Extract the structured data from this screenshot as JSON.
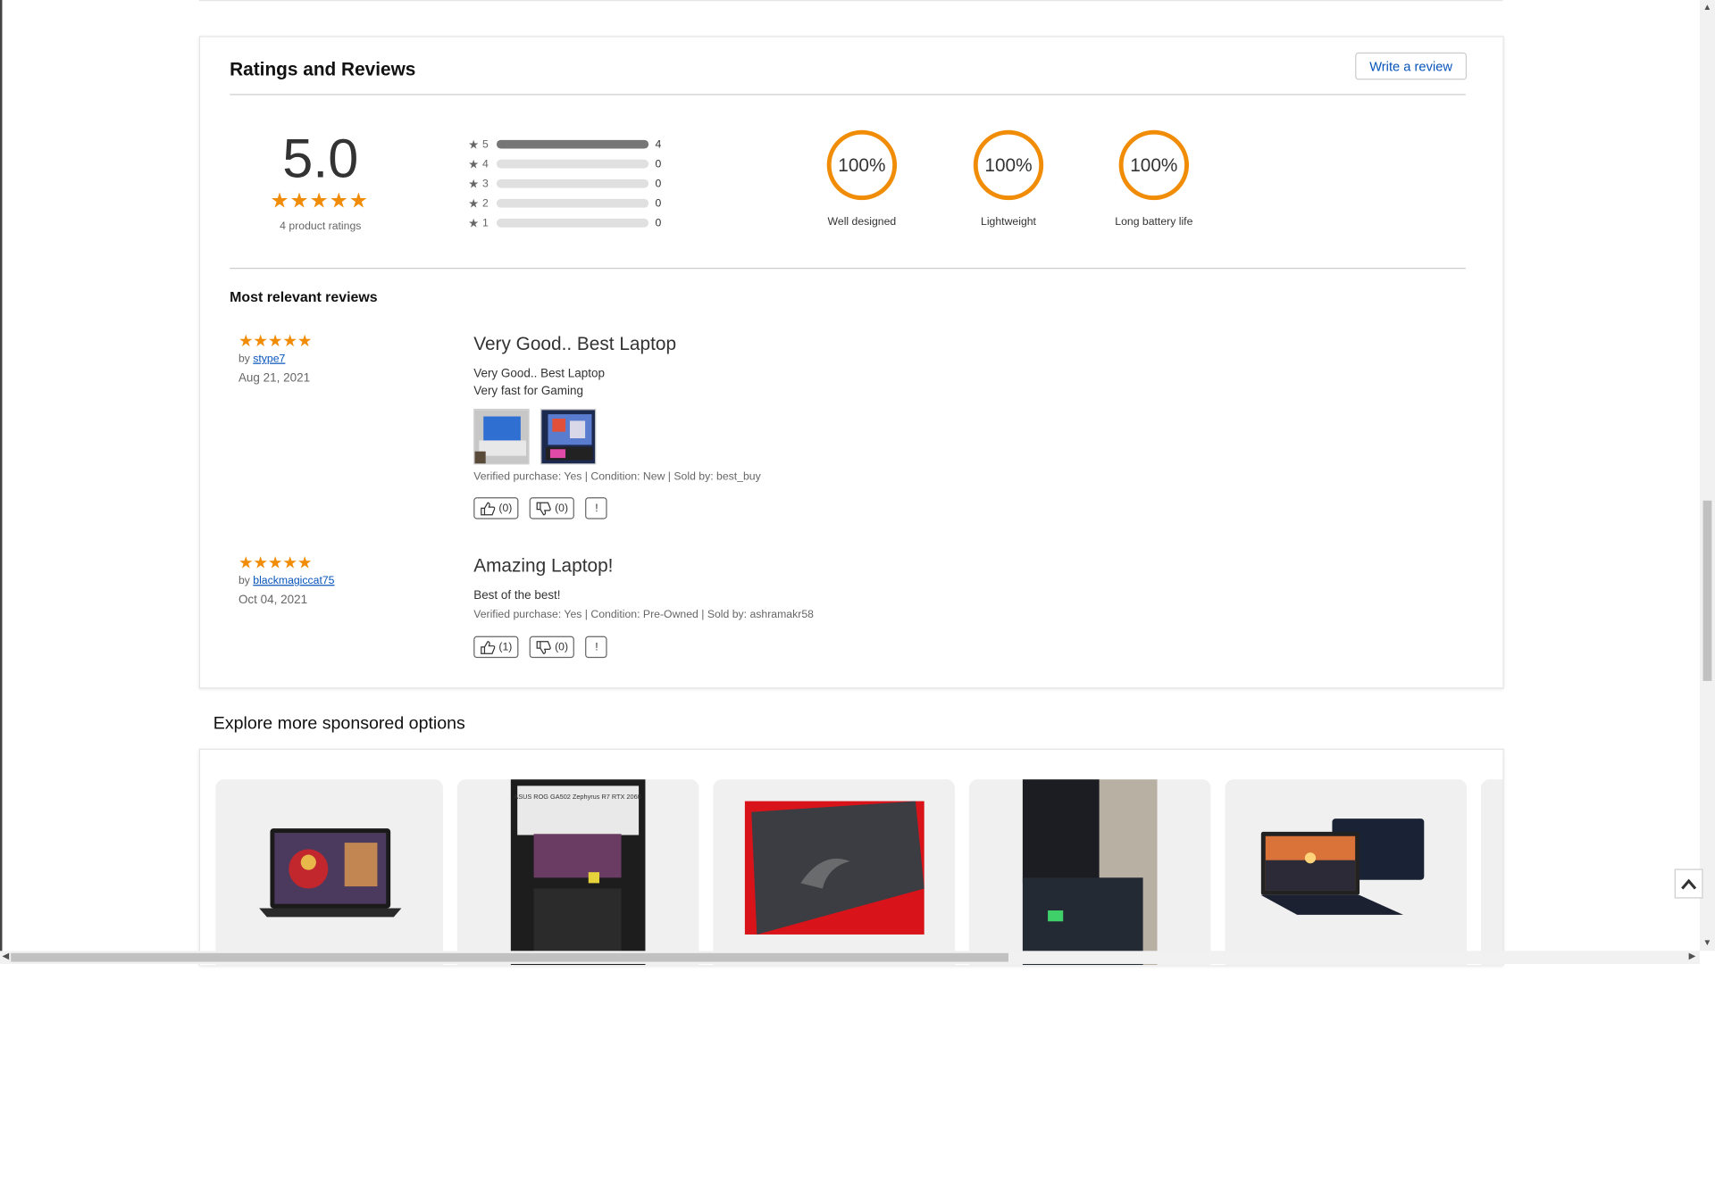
{
  "ratings": {
    "title": "Ratings and Reviews",
    "write_review": "Write a review",
    "average": "5.0",
    "count_label": "4 product ratings",
    "histogram": [
      {
        "stars": "5",
        "count": "4",
        "fraction": 1.0
      },
      {
        "stars": "4",
        "count": "0",
        "fraction": 0
      },
      {
        "stars": "3",
        "count": "0",
        "fraction": 0
      },
      {
        "stars": "2",
        "count": "0",
        "fraction": 0
      },
      {
        "stars": "1",
        "count": "0",
        "fraction": 0
      }
    ],
    "aspects": [
      {
        "percent": "100%",
        "label": "Well designed"
      },
      {
        "percent": "100%",
        "label": "Lightweight"
      },
      {
        "percent": "100%",
        "label": "Long battery life"
      }
    ],
    "accent_color": "#f18c07"
  },
  "reviews": {
    "title": "Most relevant reviews",
    "items": [
      {
        "by_prefix": "by",
        "author": "stype7",
        "date": "Aug 21, 2021",
        "title": "Very Good.. Best Laptop",
        "text_line1": "Very Good.. Best Laptop",
        "text_line2": "Very fast for Gaming",
        "meta": "Verified purchase: Yes | Condition: New | Sold by: best_buy",
        "helpful": "(0)",
        "unhelpful": "(0)",
        "flag": "!"
      },
      {
        "by_prefix": "by",
        "author": "blackmagiccat75",
        "date": "Oct 04, 2021",
        "title": "Amazing Laptop!",
        "text_line1": "Best of the best!",
        "meta": "Verified purchase: Yes | Condition: Pre-Owned | Sold by: ashramakr58",
        "helpful": "(1)",
        "unhelpful": "(0)",
        "flag": "!"
      }
    ]
  },
  "explore": {
    "title": "Explore more sponsored options",
    "box_text": "ASUS ROG GA502 Zephyrus R7 RTX 2060"
  },
  "icons": {
    "star": "star-icon",
    "thumbs_up": "thumbs-up-icon",
    "thumbs_down": "thumbs-down-icon",
    "back_to_top": "chevron-up-icon"
  }
}
